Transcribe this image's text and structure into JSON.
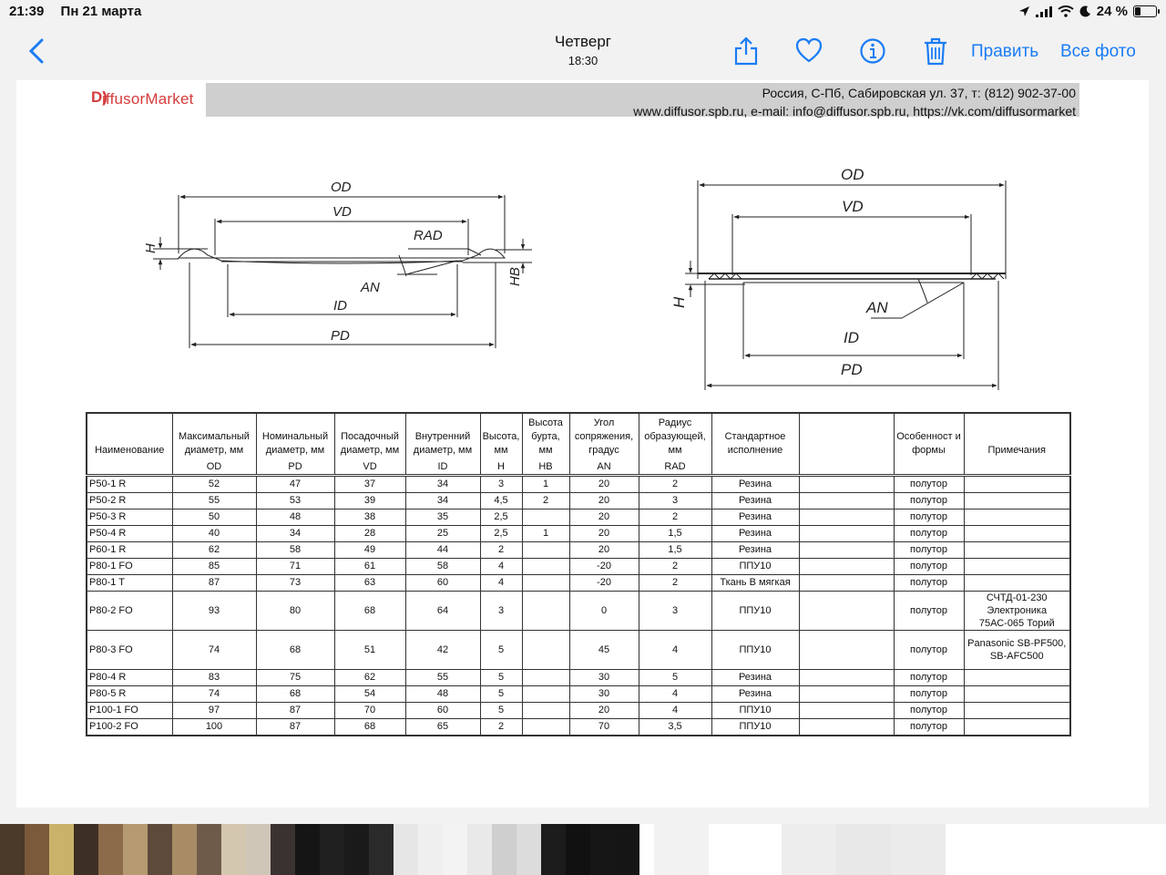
{
  "status": {
    "time": "21:39",
    "date": "Пн 21 марта",
    "battery": "24 %",
    "battery_level": 0.24
  },
  "nav": {
    "title": "Четверг",
    "subtitle": "18:30",
    "edit": "Править",
    "all_photos": "Все фото",
    "icons": [
      "back-chevron-icon",
      "share-icon",
      "heart-icon",
      "info-icon",
      "trash-icon"
    ]
  },
  "doc": {
    "logo_mark": "D)",
    "logo_text": "iffusorMarket",
    "address_line1": "Россия, С-Пб, Сабировская ул. 37, т: (812) 902-37-00",
    "address_line2": "www.diffusor.spb.ru, e-mail: info@diffusor.spb.ru, https://vk.com/diffusormarket",
    "left_diagram": {
      "labels": {
        "od": "OD",
        "vd": "VD",
        "rad": "RAD",
        "h": "H",
        "hb": "HB",
        "an": "AN",
        "id": "ID",
        "pd": "PD"
      }
    },
    "right_diagram": {
      "labels": {
        "od": "OD",
        "vd": "VD",
        "h": "H",
        "an": "AN",
        "id": "ID",
        "pd": "PD"
      }
    },
    "table": {
      "headers": [
        "Наименование",
        "Максимальный диаметр, мм",
        "Номинальный диаметр, мм",
        "Посадочный диаметр, мм",
        "Внутренний диаметр, мм",
        "Высота, мм",
        "Высота бурта, мм",
        "Угол сопряжения, градус",
        "Радиус образующей, мм",
        "Стандартное исполнение",
        "",
        "Особенност и формы",
        "Примечания"
      ],
      "codes": [
        "",
        "OD",
        "PD",
        "VD",
        "ID",
        "H",
        "HB",
        "AN",
        "RAD",
        "",
        "",
        "",
        ""
      ],
      "rows": [
        [
          "P50-1 R",
          "52",
          "47",
          "37",
          "34",
          "3",
          "1",
          "20",
          "2",
          "Резина",
          "",
          "полутор",
          ""
        ],
        [
          "P50-2 R",
          "55",
          "53",
          "39",
          "34",
          "4,5",
          "2",
          "20",
          "3",
          "Резина",
          "",
          "полутор",
          ""
        ],
        [
          "P50-3 R",
          "50",
          "48",
          "38",
          "35",
          "2,5",
          "",
          "20",
          "2",
          "Резина",
          "",
          "полутор",
          ""
        ],
        [
          "P50-4 R",
          "40",
          "34",
          "28",
          "25",
          "2,5",
          "1",
          "20",
          "1,5",
          "Резина",
          "",
          "полутор",
          ""
        ],
        [
          "P60-1 R",
          "62",
          "58",
          "49",
          "44",
          "2",
          "",
          "20",
          "1,5",
          "Резина",
          "",
          "полутор",
          ""
        ],
        [
          "P80-1 FO",
          "85",
          "71",
          "61",
          "58",
          "4",
          "",
          "-20",
          "2",
          "ППУ10",
          "",
          "полутор",
          ""
        ],
        [
          "P80-1 T",
          "87",
          "73",
          "63",
          "60",
          "4",
          "",
          "-20",
          "2",
          "Ткань В мягкая",
          "",
          "полутор",
          ""
        ],
        [
          "P80-2 FO",
          "93",
          "80",
          "68",
          "64",
          "3",
          "",
          "0",
          "3",
          "ППУ10",
          "",
          "полутор",
          "СЧТД-01-230 Электроника 75АС-065 Торий"
        ],
        [
          "P80-3 FO",
          "74",
          "68",
          "51",
          "42",
          "5",
          "",
          "45",
          "4",
          "ППУ10",
          "",
          "полутор",
          "Panasonic SB-PF500, SB-AFC500"
        ],
        [
          "P80-4 R",
          "83",
          "75",
          "62",
          "55",
          "5",
          "",
          "30",
          "5",
          "Резина",
          "",
          "полутор",
          ""
        ],
        [
          "P80-5 R",
          "74",
          "68",
          "54",
          "48",
          "5",
          "",
          "30",
          "4",
          "Резина",
          "",
          "полутор",
          ""
        ],
        [
          "P100-1 FO",
          "97",
          "87",
          "70",
          "60",
          "5",
          "",
          "20",
          "4",
          "ППУ10",
          "",
          "полутор",
          ""
        ],
        [
          "P100-2 FO",
          "100",
          "87",
          "68",
          "65",
          "2",
          "",
          "70",
          "3,5",
          "ППУ10",
          "",
          "полутор",
          ""
        ]
      ]
    }
  },
  "thumbnails": {
    "colors": [
      "#4b3a2a",
      "#7a5a3a",
      "#c9b36a",
      "#3d2f24",
      "#8b6b4a",
      "#b59a72",
      "#5e4a3a",
      "#a88c66",
      "#6f5b49",
      "#d4c7b0",
      "#cfc6b8",
      "#3a3230",
      "#151515",
      "#202020",
      "#1a1a1a",
      "#2a2a2a",
      "#e6e6e6",
      "#efefef",
      "#f3f3f3",
      "#e9e9e9",
      "#cfcfcf",
      "#dcdcdc",
      "#1c1c1c",
      "#111111",
      "#161616",
      "#151515",
      "#f2f2f2",
      "#ededed",
      "#e8e8e8",
      "#ebebeb"
    ]
  }
}
